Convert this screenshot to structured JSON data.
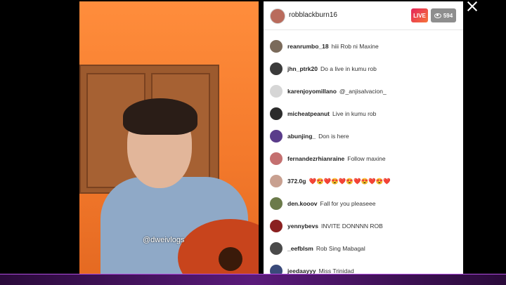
{
  "video": {
    "watermark": "@dweivlogs"
  },
  "header": {
    "host_username": "robblackburn16",
    "live_label": "LIVE",
    "viewer_count": "594"
  },
  "comments": [
    {
      "user": "reanrumbo_18",
      "text": "hiii Rob ni Maxine",
      "avatar_color": "#7a6a5a"
    },
    {
      "user": "jhn_ptrk20",
      "text": "Do a live in kumu rob",
      "avatar_color": "#3a3a3a"
    },
    {
      "user": "karenjoyomillano",
      "text": "@_anjisalvacion_",
      "avatar_color": "#d6d6d6"
    },
    {
      "user": "micheatpeanut",
      "text": "Live in kumu rob",
      "avatar_color": "#2b2b2b"
    },
    {
      "user": "abunjing_",
      "text": "Don is here",
      "avatar_color": "#5a3c8a"
    },
    {
      "user": "fernandezrhianraine",
      "text": "Follow maxine",
      "avatar_color": "#c47070"
    },
    {
      "user": "372.0g",
      "text": "❤️😍❤️😍❤️😍❤️😍❤️😍❤️",
      "avatar_color": "#c8a090"
    },
    {
      "user": "den.kooov",
      "text": "Fall for you pleaseee",
      "avatar_color": "#6b7a4a"
    },
    {
      "user": "yennybevs",
      "text": "INVITE DONNNN ROB",
      "avatar_color": "#8a2020"
    },
    {
      "user": "_eefblsm",
      "text": "Rob Sing Mabagal",
      "avatar_color": "#4a4a4a"
    },
    {
      "user": "jeedaayyy",
      "text": "Miss Trinidad",
      "avatar_color": "#3a4a7a"
    }
  ],
  "colors": {
    "live_badge": "#e4245a",
    "viewer_badge": "#8e8e8e",
    "bottom_bar": "#5a1a7a"
  }
}
